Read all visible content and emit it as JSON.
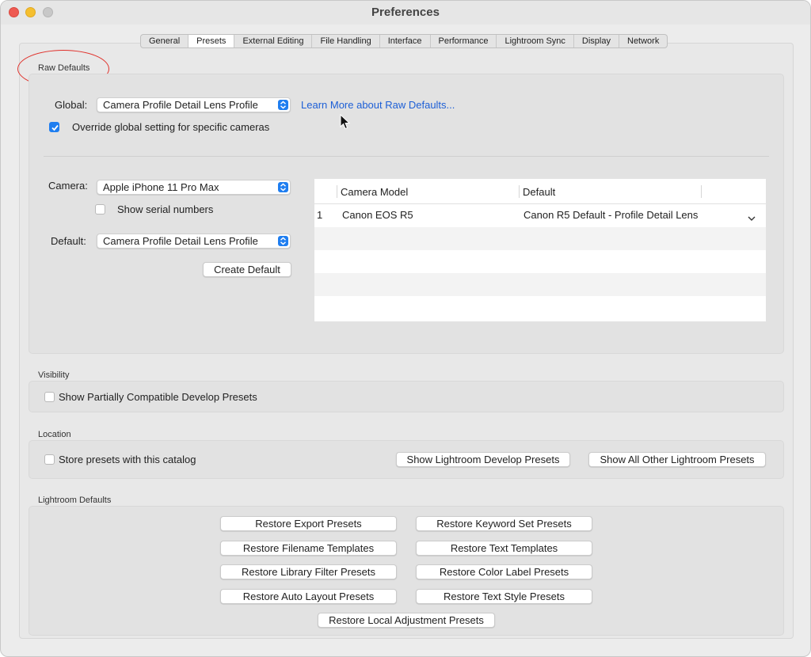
{
  "window": {
    "title": "Preferences"
  },
  "tabs": [
    {
      "label": "General"
    },
    {
      "label": "Presets",
      "active": true
    },
    {
      "label": "External Editing"
    },
    {
      "label": "File Handling"
    },
    {
      "label": "Interface"
    },
    {
      "label": "Performance"
    },
    {
      "label": "Lightroom Sync"
    },
    {
      "label": "Display"
    },
    {
      "label": "Network"
    }
  ],
  "raw_defaults": {
    "section_label": "Raw Defaults",
    "global_label": "Global:",
    "global_value": "Camera Profile Detail Lens Profile",
    "learn_more": "Learn More about Raw Defaults...",
    "override_label": "Override global setting for specific cameras",
    "override_checked": true,
    "camera_label": "Camera:",
    "camera_value": "Apple iPhone 11 Pro Max",
    "serial_label": "Show serial numbers",
    "serial_checked": false,
    "default_label": "Default:",
    "default_value": "Camera Profile Detail Lens Profile",
    "create_default": "Create Default",
    "table": {
      "headers": [
        "Camera Model",
        "Default"
      ],
      "rows": [
        {
          "index": "1",
          "model": "Canon EOS R5",
          "default": "Canon R5 Default - Profile Detail Lens"
        }
      ]
    }
  },
  "visibility": {
    "section_label": "Visibility",
    "partial_label": "Show Partially Compatible Develop Presets",
    "partial_checked": false
  },
  "location": {
    "section_label": "Location",
    "store_label": "Store presets with this catalog",
    "store_checked": false,
    "show_develop": "Show Lightroom Develop Presets",
    "show_other": "Show All Other Lightroom Presets"
  },
  "defaults": {
    "section_label": "Lightroom Defaults",
    "buttons": [
      "Restore Export Presets",
      "Restore Keyword Set Presets",
      "Restore Filename Templates",
      "Restore Text Templates",
      "Restore Library Filter Presets",
      "Restore Color Label Presets",
      "Restore Auto Layout Presets",
      "Restore Text Style Presets",
      "Restore Local Adjustment Presets"
    ]
  },
  "colors": {
    "accent": "#1f7ef0",
    "link": "#1d5fd6",
    "annotation": "#e0302a"
  }
}
